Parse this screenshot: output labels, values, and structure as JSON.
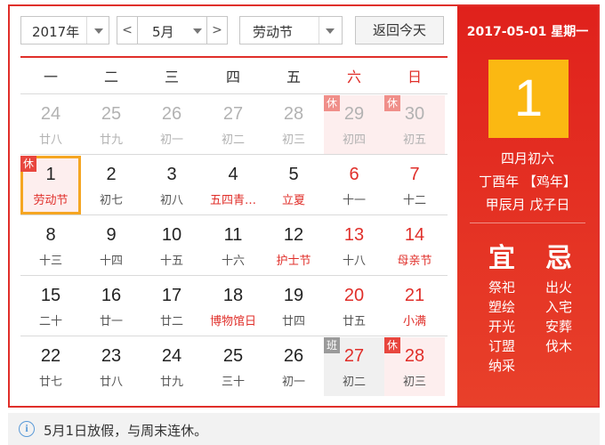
{
  "toolbar": {
    "year_value": "2017年",
    "month_value": "5月",
    "holiday_value": "劳动节",
    "prev_month_glyph": "<",
    "next_month_glyph": ">",
    "today_button": "返回今天"
  },
  "weekdays": [
    {
      "label": "一",
      "red": false
    },
    {
      "label": "二",
      "red": false
    },
    {
      "label": "三",
      "red": false
    },
    {
      "label": "四",
      "red": false
    },
    {
      "label": "五",
      "red": false
    },
    {
      "label": "六",
      "red": true
    },
    {
      "label": "日",
      "red": true
    }
  ],
  "weeks": [
    [
      {
        "day": "24",
        "sub": "廿八",
        "other": true
      },
      {
        "day": "25",
        "sub": "廿九",
        "other": true
      },
      {
        "day": "26",
        "sub": "初一",
        "other": true
      },
      {
        "day": "27",
        "sub": "初二",
        "other": true
      },
      {
        "day": "28",
        "sub": "初三",
        "other": true
      },
      {
        "day": "29",
        "sub": "初四",
        "other": true,
        "badge": "休",
        "tint": "weekend"
      },
      {
        "day": "30",
        "sub": "初五",
        "other": true,
        "badge": "休",
        "tint": "weekend"
      }
    ],
    [
      {
        "day": "1",
        "sub": "劳动节",
        "badge": "休",
        "selected": true,
        "tint": "weekend",
        "subRed": true
      },
      {
        "day": "2",
        "sub": "初七"
      },
      {
        "day": "3",
        "sub": "初八"
      },
      {
        "day": "4",
        "sub": "五四青…",
        "subRed": true
      },
      {
        "day": "5",
        "sub": "立夏",
        "subRed": true
      },
      {
        "day": "6",
        "sub": "十一",
        "dayRed": true
      },
      {
        "day": "7",
        "sub": "十二",
        "dayRed": true
      }
    ],
    [
      {
        "day": "8",
        "sub": "十三"
      },
      {
        "day": "9",
        "sub": "十四"
      },
      {
        "day": "10",
        "sub": "十五"
      },
      {
        "day": "11",
        "sub": "十六"
      },
      {
        "day": "12",
        "sub": "护士节",
        "subRed": true
      },
      {
        "day": "13",
        "sub": "十八",
        "dayRed": true
      },
      {
        "day": "14",
        "sub": "母亲节",
        "dayRed": true,
        "subRed": true
      }
    ],
    [
      {
        "day": "15",
        "sub": "二十"
      },
      {
        "day": "16",
        "sub": "廿一"
      },
      {
        "day": "17",
        "sub": "廿二"
      },
      {
        "day": "18",
        "sub": "博物馆日",
        "subRed": true
      },
      {
        "day": "19",
        "sub": "廿四"
      },
      {
        "day": "20",
        "sub": "廿五",
        "dayRed": true
      },
      {
        "day": "21",
        "sub": "小满",
        "dayRed": true,
        "subRed": true
      }
    ],
    [
      {
        "day": "22",
        "sub": "廿七"
      },
      {
        "day": "23",
        "sub": "廿八"
      },
      {
        "day": "24",
        "sub": "廿九"
      },
      {
        "day": "25",
        "sub": "三十"
      },
      {
        "day": "26",
        "sub": "初一"
      },
      {
        "day": "27",
        "sub": "初二",
        "dayRed": true,
        "badge": "班",
        "badgeGray": true,
        "tint": "gray"
      },
      {
        "day": "28",
        "sub": "初三",
        "dayRed": true,
        "badge": "休",
        "tint": "weekend"
      }
    ]
  ],
  "detail": {
    "date_line": "2017-05-01 星期一",
    "big_day": "1",
    "lunar_date": "四月初六",
    "year_ganzhi": "丁酉年 【鸡年】",
    "month_day_ganzhi": "甲辰月 戊子日",
    "yi_label": "宜",
    "ji_label": "忌",
    "yi_items": [
      "祭祀",
      "塑绘",
      "开光",
      "订盟",
      "纳采"
    ],
    "ji_items": [
      "出火",
      "入宅",
      "安葬",
      "伐木"
    ]
  },
  "notice": {
    "icon": "info-icon",
    "text": "5月1日放假，与周末连休。"
  },
  "colors": {
    "accent_red": "#e02f2a",
    "highlight_yellow": "#fbb812",
    "selected_border": "#f5a623"
  }
}
